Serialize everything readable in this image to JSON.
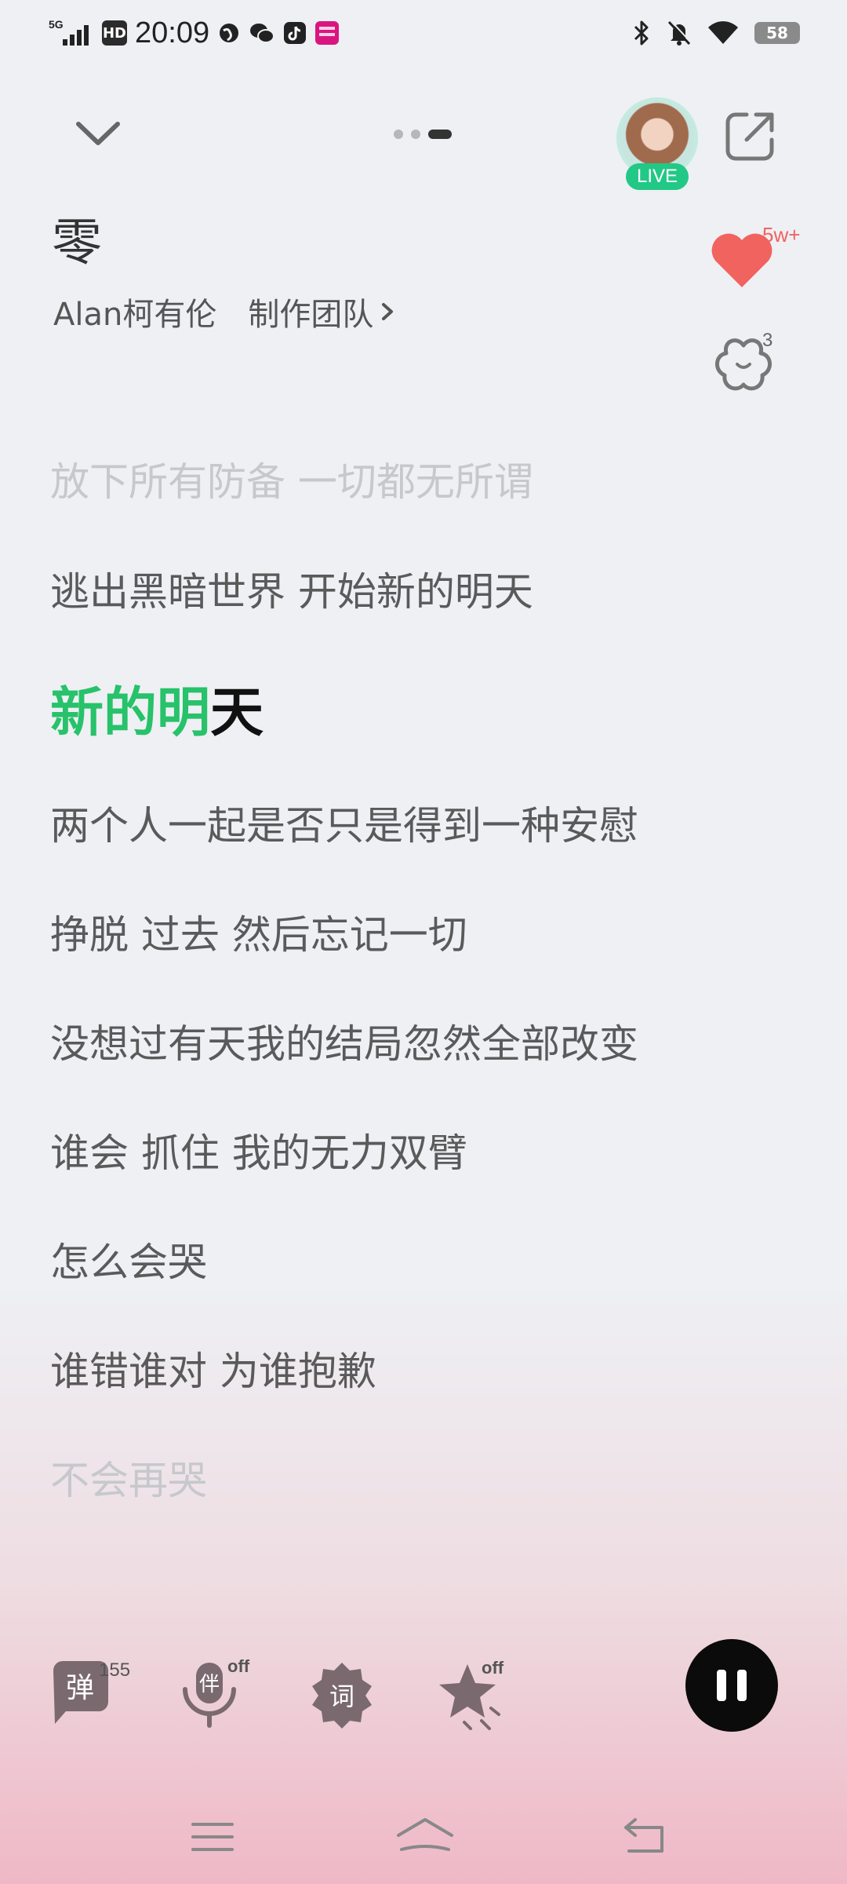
{
  "status_bar": {
    "network": "5G",
    "hd": "HD",
    "time": "20:09",
    "battery": "58"
  },
  "player": {
    "live_label": "LIVE",
    "song_title": "零",
    "artist": "Alan柯有伦",
    "credits_label": "制作团队",
    "like_count": "5w+",
    "comment_count": "3"
  },
  "lyrics": {
    "lines": [
      "放下所有防备 一切都无所谓",
      "逃出黑暗世界 开始新的明天",
      "两个人一起是否只是得到一种安慰",
      "挣脱 过去 然后忘记一切",
      "没想过有天我的结局忽然全部改变",
      "谁会 抓住 我的无力双臂",
      "怎么会哭",
      "谁错谁对 为谁抱歉",
      "不会再哭"
    ],
    "current_sung": "新的明",
    "current_unsung": "天"
  },
  "controls": {
    "danmu_label": "弹",
    "danmu_count": "155",
    "accompany_label": "伴",
    "accompany_state": "off",
    "lyrics_label": "词",
    "effect_state": "off"
  },
  "colors": {
    "accent_green": "#27c26a",
    "like_red": "#f1635f",
    "live_green": "#22c886"
  }
}
